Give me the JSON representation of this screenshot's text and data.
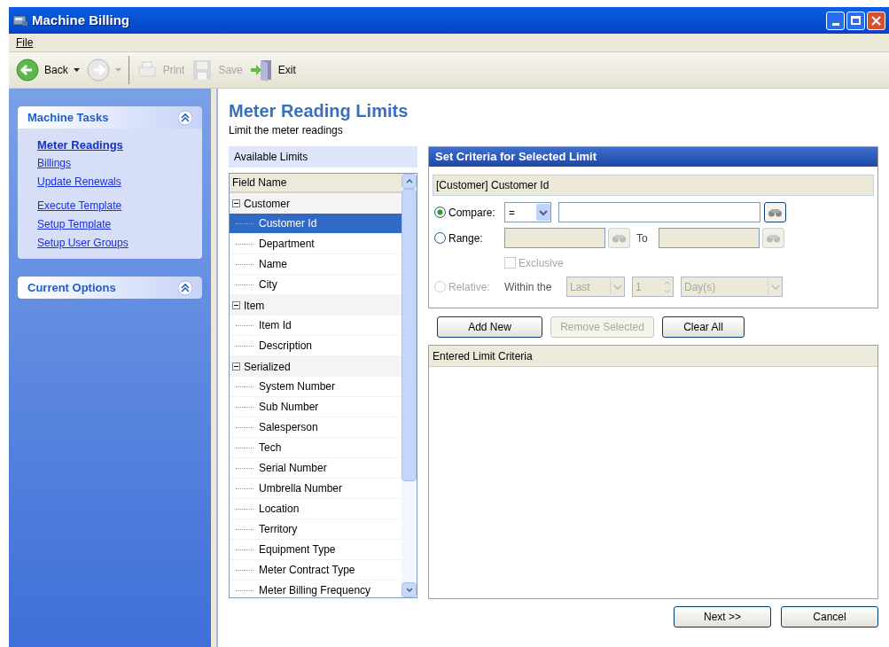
{
  "window": {
    "title": "Machine Billing"
  },
  "menu": [
    {
      "label": "File"
    }
  ],
  "toolbar": [
    {
      "kind": "back",
      "label": "Back",
      "disabled": false,
      "dropdown": true
    },
    {
      "kind": "forward",
      "disabled": true,
      "dropdown": true
    },
    {
      "kind": "print",
      "label": "Print",
      "disabled": true
    },
    {
      "kind": "save",
      "label": "Save",
      "disabled": true
    },
    {
      "kind": "exit",
      "label": "Exit",
      "disabled": false
    }
  ],
  "sidebar": {
    "panels": [
      {
        "title": "Machine Tasks",
        "expanded": true,
        "link_groups": [
          [
            {
              "label": "Meter Readings",
              "selected": true
            },
            {
              "label": "Billings",
              "selected": false
            },
            {
              "label": "Update Renewals",
              "selected": false
            }
          ],
          [
            {
              "label": "Execute Template",
              "selected": false
            },
            {
              "label": "Setup Template",
              "selected": false
            },
            {
              "label": "Setup User Groups",
              "selected": false
            }
          ]
        ]
      },
      {
        "title": "Current Options",
        "expanded": true
      }
    ]
  },
  "page": {
    "title": "Meter Reading Limits",
    "subtitle": "Limit the meter readings"
  },
  "available_limits": {
    "title": "Available Limits",
    "column": "Field Name",
    "tree": [
      {
        "label": "Customer",
        "expanded": true,
        "selected": false,
        "children": [
          {
            "label": "Customer Id",
            "selected": true
          },
          {
            "label": "Department",
            "selected": false
          },
          {
            "label": "Name",
            "selected": false
          },
          {
            "label": "City",
            "selected": false
          }
        ]
      },
      {
        "label": "Item",
        "expanded": true,
        "selected": false,
        "children": [
          {
            "label": "Item Id",
            "selected": false
          },
          {
            "label": "Description",
            "selected": false
          }
        ]
      },
      {
        "label": "Serialized",
        "expanded": true,
        "selected": false,
        "children": [
          {
            "label": "System Number",
            "selected": false
          },
          {
            "label": "Sub Number",
            "selected": false
          },
          {
            "label": "Salesperson",
            "selected": false
          },
          {
            "label": "Tech",
            "selected": false
          },
          {
            "label": "Serial Number",
            "selected": false
          },
          {
            "label": "Umbrella Number",
            "selected": false
          },
          {
            "label": "Location",
            "selected": false
          },
          {
            "label": "Territory",
            "selected": false
          },
          {
            "label": "Equipment Type",
            "selected": false
          },
          {
            "label": "Meter Contract Type",
            "selected": false
          },
          {
            "label": "Meter Billing Frequency",
            "selected": false
          }
        ]
      }
    ]
  },
  "criteria": {
    "title": "Set Criteria for Selected Limit",
    "selected_field": "[Customer] Customer Id",
    "compare": {
      "label": "Compare:",
      "selected": true,
      "operator": "="
    },
    "range": {
      "label": "Range:",
      "selected": false,
      "to_label": "To"
    },
    "exclusive": {
      "label": "Exclusive",
      "checked": false,
      "disabled": true
    },
    "relative": {
      "label": "Relative:",
      "selected": false,
      "disabled": true,
      "within_label": "Within the",
      "period": "Last",
      "count": "1",
      "unit": "Day(s)"
    }
  },
  "criteria_buttons": [
    {
      "label": "Add New",
      "disabled": false
    },
    {
      "label": "Remove Selected",
      "disabled": true
    },
    {
      "label": "Clear All",
      "disabled": false
    }
  ],
  "entered_criteria": {
    "header": "Entered Limit Criteria"
  },
  "footer_buttons": [
    {
      "label": "Next >>",
      "disabled": false
    },
    {
      "label": "Cancel",
      "disabled": false
    }
  ]
}
